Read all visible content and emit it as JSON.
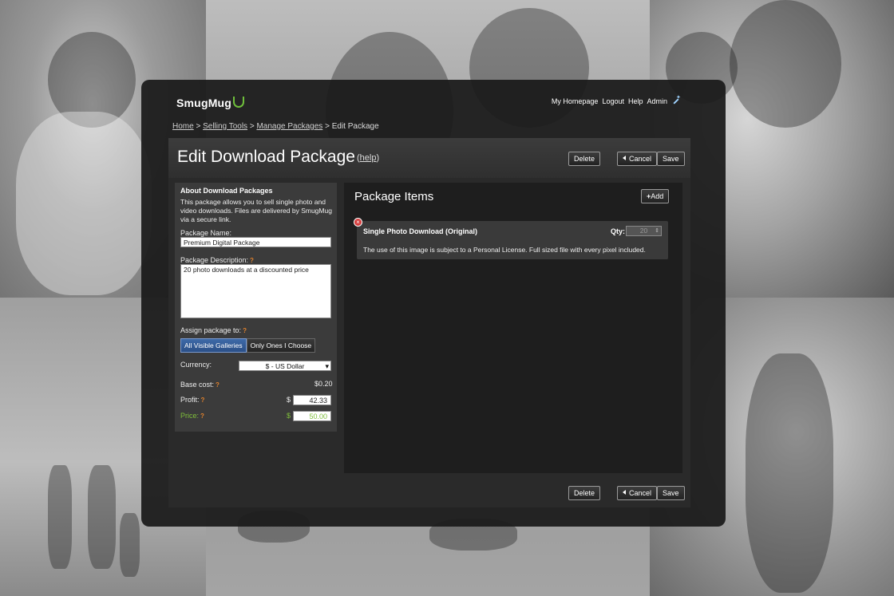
{
  "brand": {
    "name": "SmugMug",
    "accent": "#6fbf3b"
  },
  "topnav": [
    "My Homepage",
    "Logout",
    "Help",
    "Admin"
  ],
  "breadcrumb": {
    "home": "Home",
    "selling_tools": "Selling Tools",
    "manage_packages": "Manage Packages",
    "current": "Edit Package",
    "sep": ">"
  },
  "page": {
    "title": "Edit Download Package",
    "help": "help"
  },
  "buttons": {
    "delete": "Delete",
    "cancel": "Cancel",
    "save": "Save",
    "add": "Add"
  },
  "about": {
    "heading": "About Download Packages",
    "text": "This package allows you to sell single photo and video downloads. Files are delivered by SmugMug via a secure link."
  },
  "form": {
    "package_name_label": "Package Name:",
    "package_name_value": "Premium Digital Package",
    "package_desc_label": "Package Description:",
    "package_desc_value": "20 photo downloads at a discounted price",
    "assign_label": "Assign package to:",
    "assign_options": [
      "All Visible Galleries",
      "Only Ones I Choose"
    ],
    "assign_selected": "All Visible Galleries",
    "currency_label": "Currency:",
    "currency_value": "$ - US Dollar",
    "base_cost_label": "Base cost:",
    "base_cost_value": "$0.20",
    "profit_label": "Profit:",
    "profit_currency": "$",
    "profit_value": "42.33",
    "price_label": "Price:",
    "price_currency": "$",
    "price_value": "50.00",
    "question_mark": "?"
  },
  "package_items": {
    "title": "Package Items",
    "items": [
      {
        "name": "Single Photo Download (Original)",
        "qty_label": "Qty:",
        "qty": "20",
        "description": "The use of this image is subject to a Personal License. Full sized file with every pixel included."
      }
    ]
  },
  "colors": {
    "price_green": "#7fbf3a",
    "help_orange": "#e0822d",
    "selected_blue": "#3e6aa8"
  }
}
